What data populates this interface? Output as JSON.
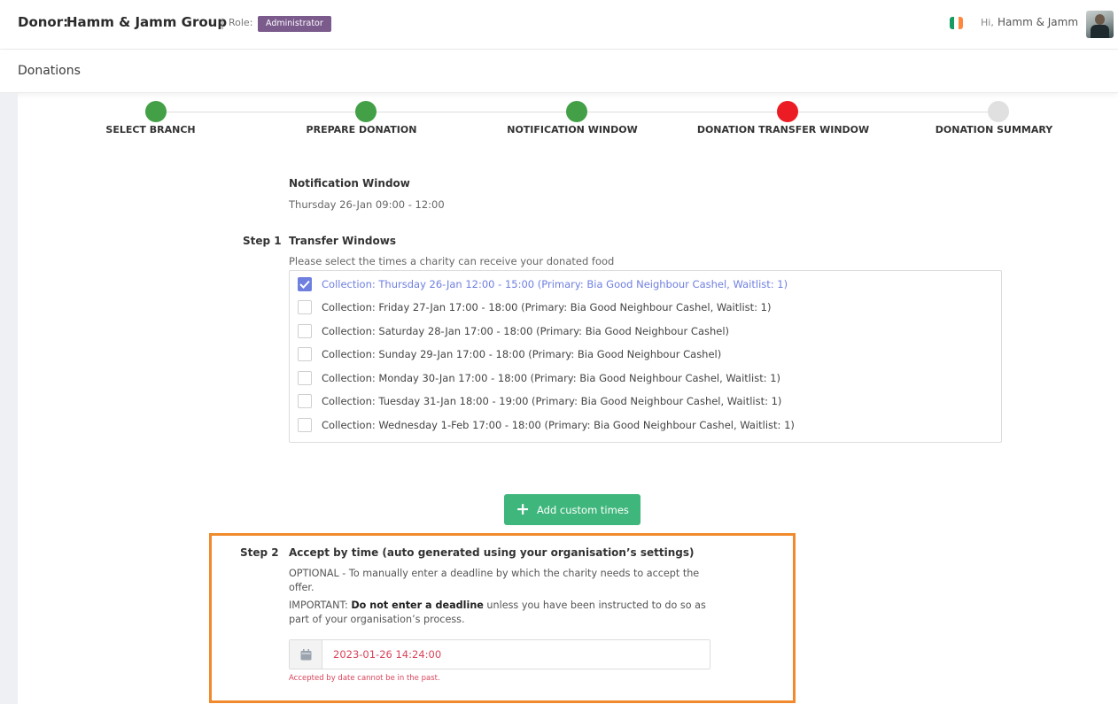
{
  "header": {
    "donor_label": "Donor:",
    "donor_name": "Hamm & Jamm Group",
    "separator": "|",
    "role_label": "Role:",
    "role_badge": "Administrator",
    "greeting": "Hi,",
    "user_name": "Hamm & Jamm"
  },
  "page": {
    "title": "Donations"
  },
  "stepper": [
    {
      "label": "SELECT BRANCH",
      "status": "complete",
      "color": "#43a047"
    },
    {
      "label": "PREPARE DONATION",
      "status": "complete",
      "color": "#43a047"
    },
    {
      "label": "NOTIFICATION WINDOW",
      "status": "complete",
      "color": "#43a047"
    },
    {
      "label": "DONATION TRANSFER WINDOW",
      "status": "current",
      "color": "#ec1c24"
    },
    {
      "label": "DONATION SUMMARY",
      "status": "pending",
      "color": "#e0e0e0"
    }
  ],
  "notification": {
    "title": "Notification Window",
    "value": "Thursday 26-Jan 09:00 - 12:00"
  },
  "step1": {
    "number": "Step 1",
    "title": "Transfer Windows",
    "hint": "Please select the times a charity can receive your donated food",
    "windows": [
      {
        "label": "Collection: Thursday 26-Jan 12:00 - 15:00 (Primary: Bia Good Neighbour Cashel, Waitlist: 1)",
        "checked": true
      },
      {
        "label": "Collection: Friday 27-Jan 17:00 - 18:00 (Primary: Bia Good Neighbour Cashel, Waitlist: 1)",
        "checked": false
      },
      {
        "label": "Collection: Saturday 28-Jan 17:00 - 18:00 (Primary: Bia Good Neighbour Cashel)",
        "checked": false
      },
      {
        "label": "Collection: Sunday 29-Jan 17:00 - 18:00 (Primary: Bia Good Neighbour Cashel)",
        "checked": false
      },
      {
        "label": "Collection: Monday 30-Jan 17:00 - 18:00 (Primary: Bia Good Neighbour Cashel, Waitlist: 1)",
        "checked": false
      },
      {
        "label": "Collection: Tuesday 31-Jan 18:00 - 19:00 (Primary: Bia Good Neighbour Cashel, Waitlist: 1)",
        "checked": false
      },
      {
        "label": "Collection: Wednesday 1-Feb 17:00 - 18:00 (Primary: Bia Good Neighbour Cashel, Waitlist: 1)",
        "checked": false
      }
    ],
    "add_button": "Add custom times"
  },
  "step2": {
    "number": "Step 2",
    "title": "Accept by time (auto generated using your organisation’s settings)",
    "optional_text": "OPTIONAL - To manually enter a deadline by which the charity needs to accept the offer.",
    "important_prefix": "IMPORTANT: ",
    "important_bold": "Do not enter a deadline",
    "important_suffix": " unless you have been instructed to do so as part of your organisation’s process.",
    "date_value": "2023-01-26 14:24:00",
    "error": "Accepted by date cannot be in the past."
  },
  "colors": {
    "accent_purple": "#7b5a8c",
    "checkbox_blue": "#6f7fe0",
    "button_green": "#3fb67b",
    "highlight_orange": "#f08a2c",
    "error_red": "#d9445b"
  }
}
